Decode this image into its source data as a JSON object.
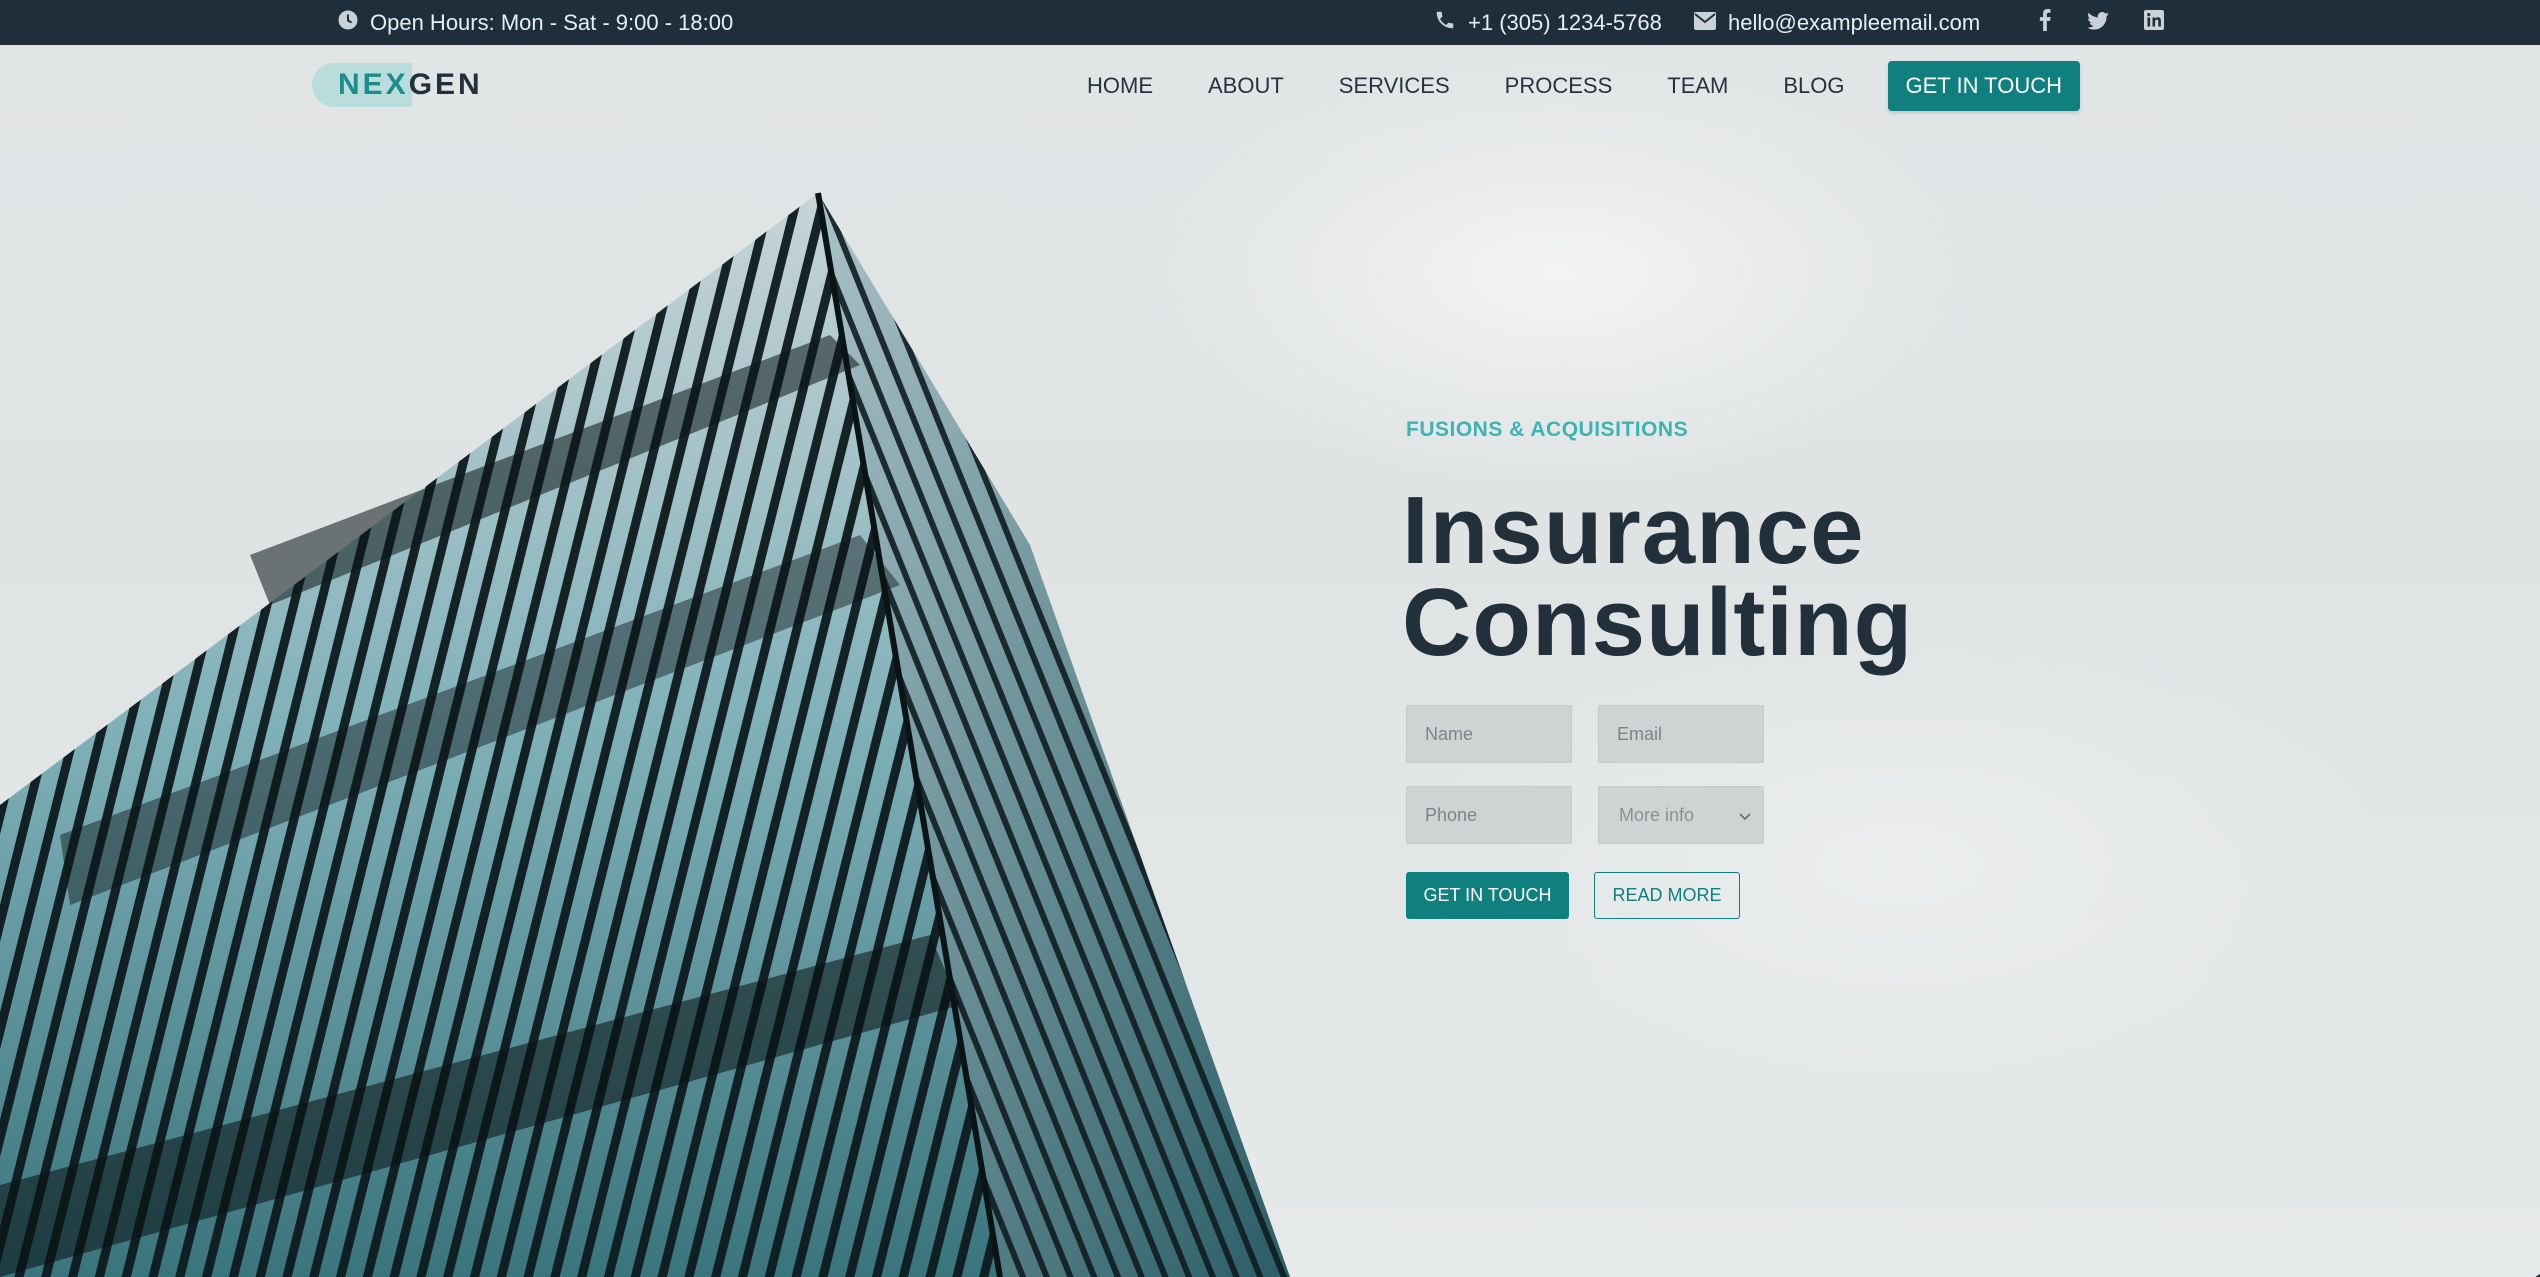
{
  "topbar": {
    "hours": "Open Hours: Mon - Sat - 9:00 - 18:00",
    "phone": "+1 (305) 1234-5768",
    "email": "hello@exampleemail.com",
    "social": [
      "facebook-icon",
      "twitter-icon",
      "linkedin-icon"
    ]
  },
  "header": {
    "logo_part1": "NEX",
    "logo_part2": "GEN",
    "nav": [
      "HOME",
      "ABOUT",
      "SERVICES",
      "PROCESS",
      "TEAM",
      "BLOG"
    ],
    "cta": "GET IN TOUCH"
  },
  "hero": {
    "eyebrow": "FUSIONS & ACQUISITIONS",
    "title_line1": "Insurance",
    "title_line2": "Consulting",
    "form": {
      "name_placeholder": "Name",
      "email_placeholder": "Email",
      "phone_placeholder": "Phone",
      "more_info_selected": "More info"
    },
    "primary_button": "GET IN TOUCH",
    "secondary_button": "READ MORE"
  },
  "colors": {
    "topbar_bg": "#1e2e3b",
    "accent": "#0f7f80",
    "accent_light": "#3fb2b3",
    "heading": "#22303c"
  }
}
